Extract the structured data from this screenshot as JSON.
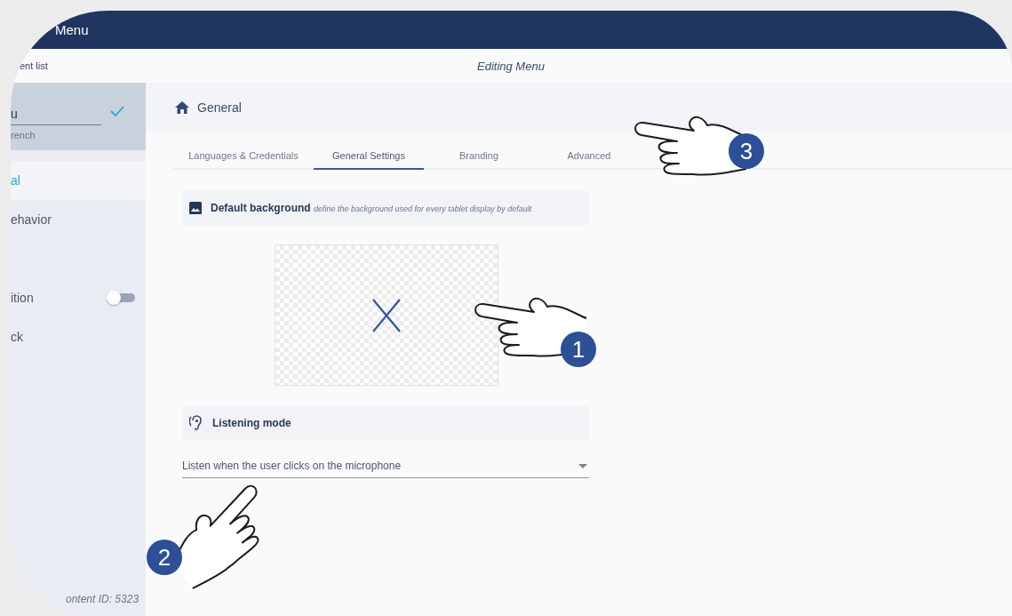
{
  "header": {
    "title": "Menu"
  },
  "subbar": {
    "back_link": "ent list",
    "title": "Editing Menu"
  },
  "sidebar": {
    "name_field": {
      "value": "u"
    },
    "language": "rench",
    "items": [
      {
        "label": "al",
        "selected": true
      },
      {
        "label": "ehavior",
        "selected": false
      },
      {
        "label": "ition",
        "selected": false,
        "switch_on": false
      },
      {
        "label": "ck",
        "selected": false
      }
    ],
    "footer": "ontent ID: 5323"
  },
  "section": {
    "title": "General"
  },
  "tabs": [
    {
      "label": "Languages & Credentials",
      "selected": false
    },
    {
      "label": "General Settings",
      "selected": true
    },
    {
      "label": "Branding",
      "selected": false
    },
    {
      "label": "Advanced",
      "selected": false
    }
  ],
  "background_card": {
    "title": "Default background",
    "hint": "define the background used for every tablet display by default"
  },
  "listening_card": {
    "title": "Listening mode",
    "value": "Listen when the user clicks on the microphone"
  },
  "callouts": [
    {
      "number": "1",
      "kind": "left"
    },
    {
      "number": "2",
      "kind": "up-right"
    },
    {
      "number": "3",
      "kind": "left"
    }
  ]
}
